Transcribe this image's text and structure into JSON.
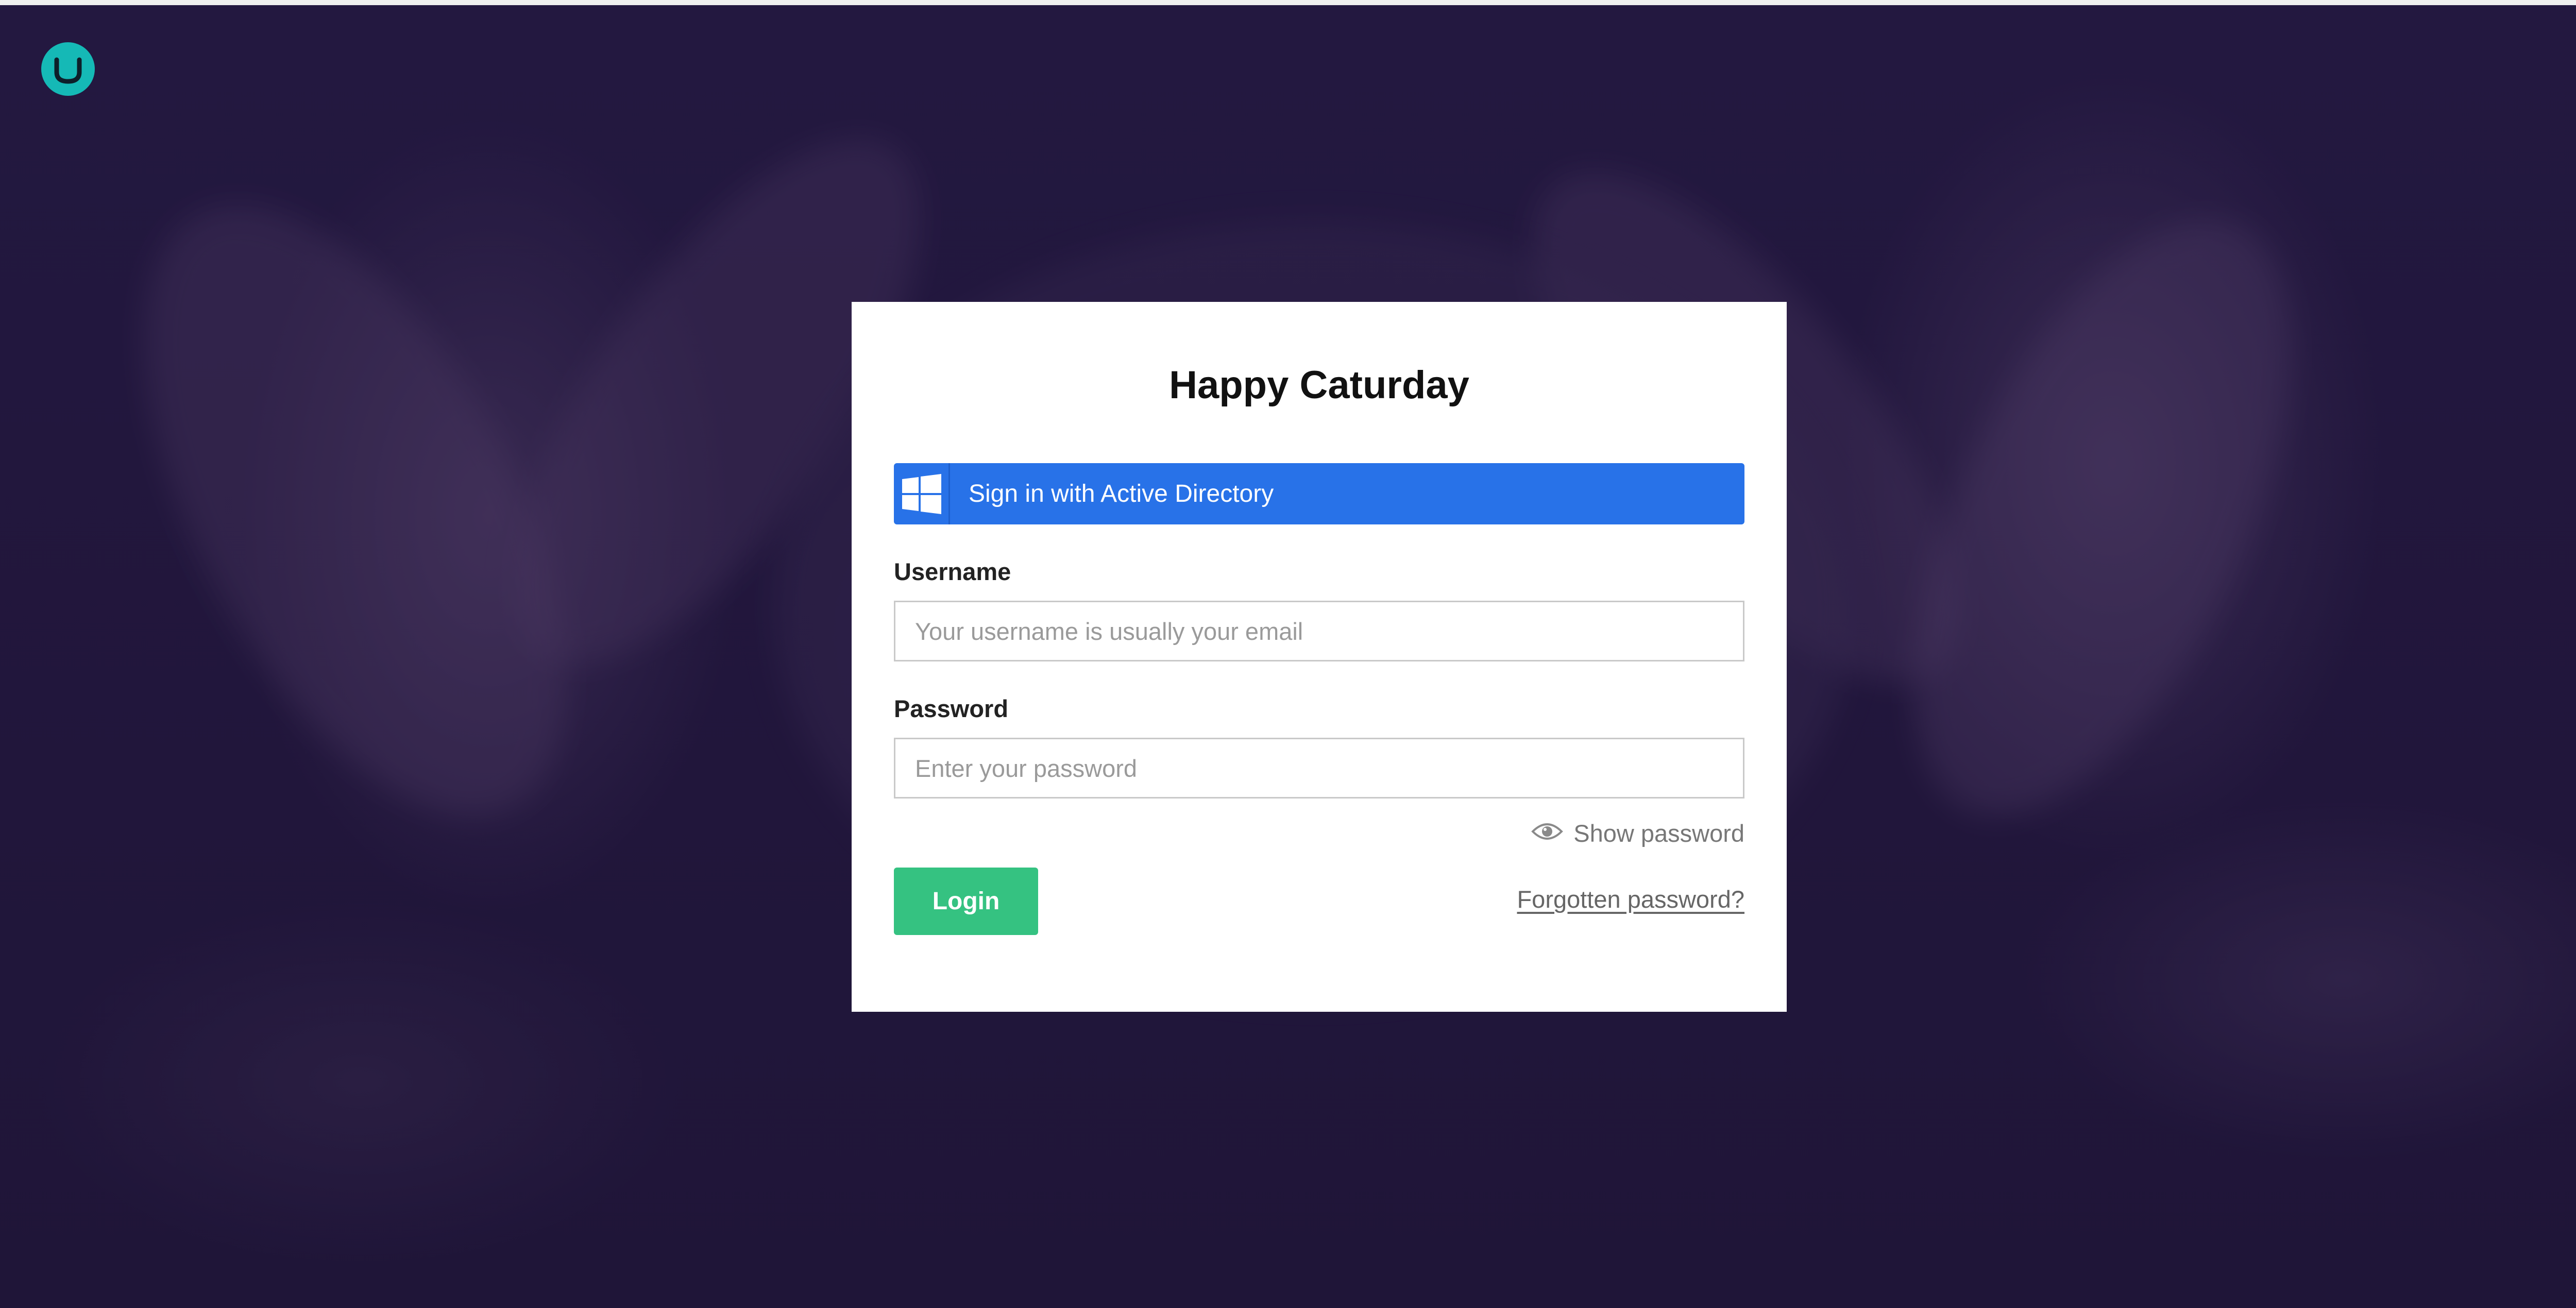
{
  "app": {
    "logo_icon": "umbraco-logo-icon",
    "accent_color": "#15b9b6"
  },
  "login": {
    "title": "Happy Caturday",
    "external_login": {
      "label": "Sign in with Active Directory",
      "icon": "windows-logo-icon",
      "color": "#2872e8"
    },
    "username": {
      "label": "Username",
      "value": "",
      "placeholder": "Your username is usually your email"
    },
    "password": {
      "label": "Password",
      "value": "",
      "placeholder": "Enter your password"
    },
    "show_password": {
      "label": "Show password",
      "icon": "eye-icon"
    },
    "login_button": {
      "label": "Login",
      "color": "#35c281"
    },
    "forgot_link": {
      "label": "Forgotten password?"
    }
  }
}
